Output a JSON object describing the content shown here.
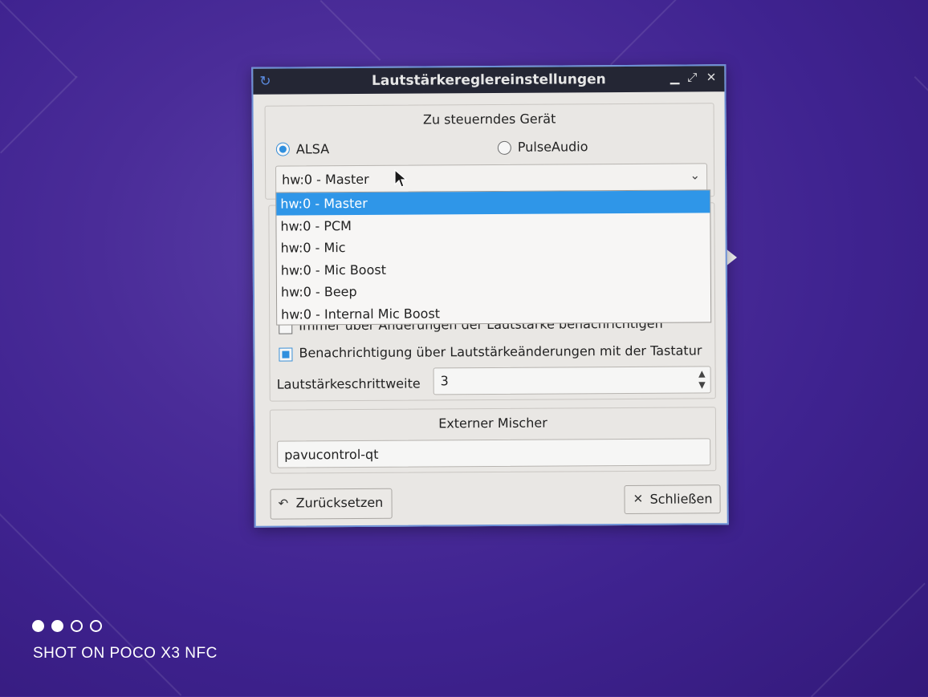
{
  "window": {
    "title": "Lautstärkereglereinstellungen",
    "app_icon": "refresh-logo-icon",
    "controls": [
      "minimize-icon",
      "maximize-icon",
      "close-icon"
    ]
  },
  "device_group": {
    "title": "Zu steuerndes Gerät",
    "radio_alsa": "ALSA",
    "radio_pulseaudio": "PulseAudio",
    "selected_backend": "ALSA",
    "combo_value": "hw:0 - Master",
    "dropdown_items": [
      "hw:0 - Master",
      "hw:0 - PCM",
      "hw:0 - Mic",
      "hw:0 - Mic Boost",
      "hw:0 - Beep",
      "hw:0 - Internal Mic Boost"
    ],
    "dropdown_selected_index": 0
  },
  "behavior_group": {
    "check_always_notify": "Immer über Änderungen der Lautstärke benachrichtigen",
    "check_always_notify_checked": false,
    "check_keyboard_notify": "Benachrichtigung über Lautstärkeänderungen mit der Tastatur",
    "check_keyboard_notify_checked": true,
    "step_label": "Lautstärkeschrittweite",
    "step_value": "3"
  },
  "mixer_group": {
    "title": "Externer Mischer",
    "command": "pavucontrol-qt"
  },
  "buttons": {
    "reset": "Zurücksetzen",
    "close": "Schließen"
  },
  "photo_overlay": {
    "watermark": "SHOT ON POCO X3 NFC"
  },
  "colors": {
    "accent": "#2f96e8",
    "titlebar": "#242634",
    "window_bg": "#e9e7e4",
    "desktop": "#4a2c98"
  }
}
